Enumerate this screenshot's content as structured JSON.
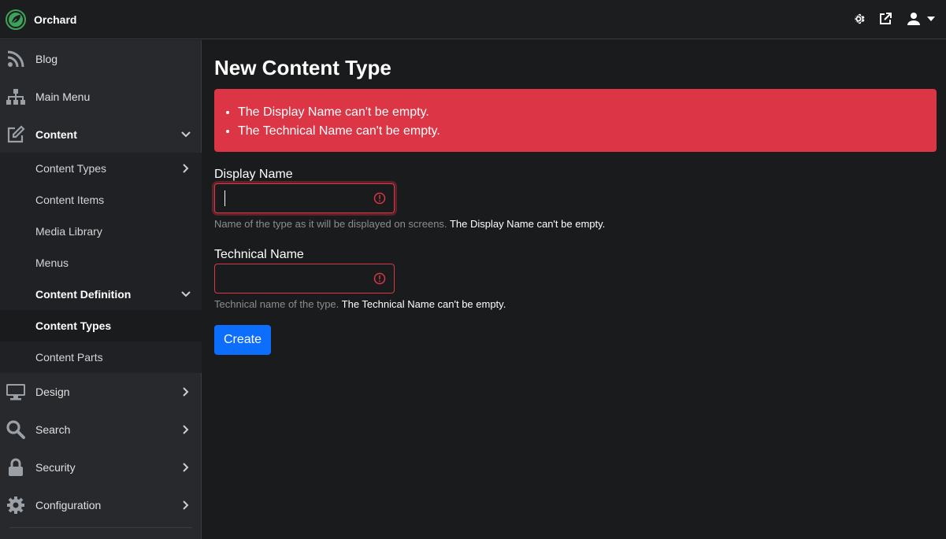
{
  "brand": {
    "name": "Orchard",
    "accent": "#3ea35a"
  },
  "topbar": {
    "icons": [
      "gear-icon",
      "external-link-icon",
      "user-icon",
      "caret-down-icon"
    ]
  },
  "sidebar": {
    "items": [
      {
        "label": "Blog",
        "icon": "rss-icon"
      },
      {
        "label": "Main Menu",
        "icon": "sitemap-icon"
      },
      {
        "label": "Content",
        "icon": "edit-icon",
        "expanded": true
      },
      {
        "label": "Design",
        "icon": "monitor-icon"
      },
      {
        "label": "Search",
        "icon": "search-icon"
      },
      {
        "label": "Security",
        "icon": "lock-icon"
      },
      {
        "label": "Configuration",
        "icon": "cog-icon"
      }
    ],
    "content_children": [
      {
        "label": "Content Types"
      },
      {
        "label": "Content Items"
      },
      {
        "label": "Media Library"
      },
      {
        "label": "Menus"
      },
      {
        "label": "Content Definition",
        "expanded": true
      },
      {
        "label": "Content Types",
        "active": true
      },
      {
        "label": "Content Parts"
      }
    ]
  },
  "main": {
    "title": "New Content Type",
    "alert": {
      "color": "#dc3545",
      "errors": [
        "The Display Name can't be empty.",
        "The Technical Name can't be empty."
      ]
    },
    "display_name": {
      "label": "Display Name",
      "value": "",
      "help": "Name of the type as it will be displayed on screens.",
      "error": "The Display Name can't be empty."
    },
    "technical_name": {
      "label": "Technical Name",
      "value": "",
      "help": "Technical name of the type.",
      "error": "The Technical Name can't be empty."
    },
    "create_label": "Create"
  }
}
